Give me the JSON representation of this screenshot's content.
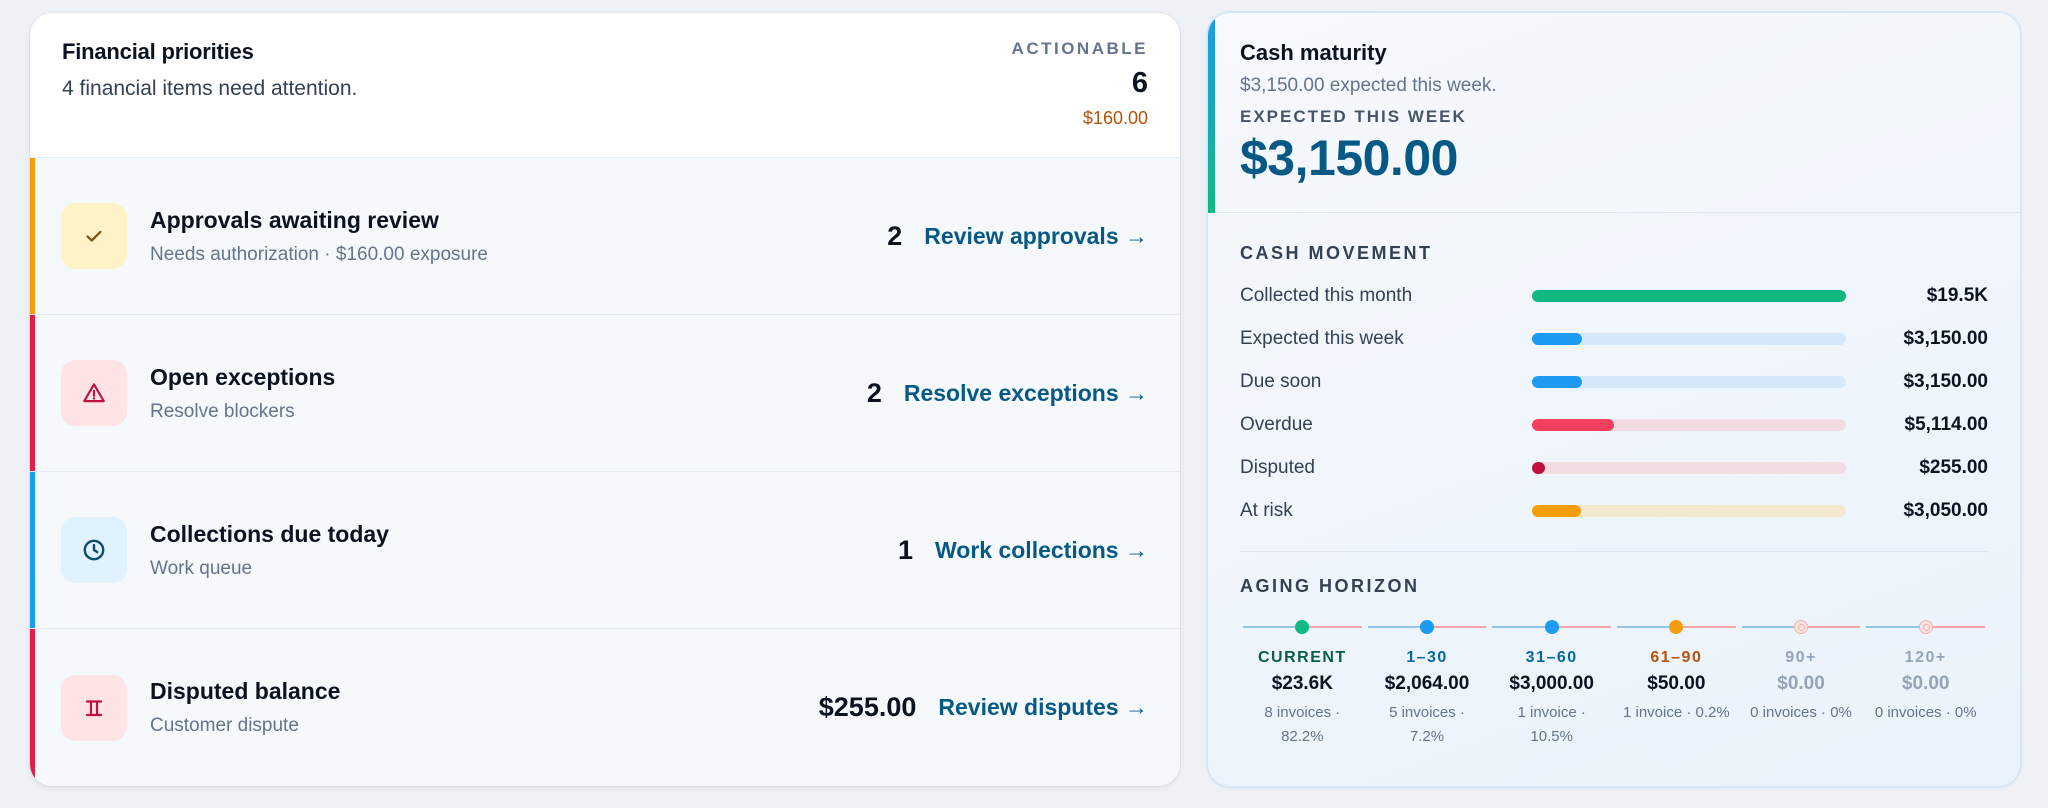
{
  "priorities": {
    "title": "Financial priorities",
    "subtitle": "4 financial items need attention.",
    "actionable_label": "ACTIONABLE",
    "actionable_count": "6",
    "actionable_amount": "$160.00",
    "items": [
      {
        "title": "Approvals awaiting review",
        "subtitle": "Needs authorization · $160.00 exposure",
        "count": "2",
        "link": "Review approvals →",
        "accent": "#f59e0b",
        "icon": "check-icon",
        "icon_color": "#854d0e",
        "icon_bg": "#fef3c7"
      },
      {
        "title": "Open exceptions",
        "subtitle": "Resolve blockers",
        "count": "2",
        "link": "Resolve exceptions →",
        "accent": "#e11d48",
        "icon": "warning-triangle-icon",
        "icon_color": "#be123c",
        "icon_bg": "#ffe4e6"
      },
      {
        "title": "Collections due today",
        "subtitle": "Work queue",
        "count": "1",
        "link": "Work collections →",
        "accent": "#1d9bf0",
        "icon": "clock-icon",
        "icon_color": "#0c4a6e",
        "icon_bg": "#e0f2fe"
      },
      {
        "title": "Disputed balance",
        "subtitle": "Customer dispute",
        "count": "$255.00",
        "link": "Review disputes →",
        "accent": "#e11d48",
        "icon": "dispute-pillar-icon",
        "icon_color": "#be123c",
        "icon_bg": "#ffe4e6"
      }
    ]
  },
  "cash": {
    "title": "Cash maturity",
    "subtitle": "$3,150.00 expected this week.",
    "label": "EXPECTED THIS WEEK",
    "big_value": "$3,150.00",
    "movement_label": "CASH MOVEMENT",
    "movement": [
      {
        "name": "Collected this month",
        "value": "$19.5K",
        "fill": 1.0,
        "color": "#10b981",
        "track": "#d1fae5"
      },
      {
        "name": "Expected this week",
        "value": "$3,150.00",
        "fill": 0.16,
        "color": "#1d9bf0",
        "track": "#d6e9fa"
      },
      {
        "name": "Due soon",
        "value": "$3,150.00",
        "fill": 0.16,
        "color": "#1d9bf0",
        "track": "#d6e9fa"
      },
      {
        "name": "Overdue",
        "value": "$5,114.00",
        "fill": 0.26,
        "color": "#f43f5e",
        "track": "#f3dbe2"
      },
      {
        "name": "Disputed",
        "value": "$255.00",
        "fill": 0.04,
        "color": "#be123c",
        "track": "#f3dbe2"
      },
      {
        "name": "At risk",
        "value": "$3,050.00",
        "fill": 0.155,
        "color": "#f59e0b",
        "track": "#f5e8d0"
      }
    ],
    "aging_label": "AGING HORIZON",
    "aging": [
      {
        "label": "CURRENT",
        "amount": "$23.6K",
        "meta": "8 invoices · 82.2%",
        "dot": "#10b981",
        "label_color": "#065f46",
        "muted": false
      },
      {
        "label": "1–30",
        "amount": "$2,064.00",
        "meta": "5 invoices · 7.2%",
        "dot": "#1d9bf0",
        "label_color": "#0369a1",
        "muted": false
      },
      {
        "label": "31–60",
        "amount": "$3,000.00",
        "meta": "1 invoice · 10.5%",
        "dot": "#1d9bf0",
        "label_color": "#0369a1",
        "muted": false
      },
      {
        "label": "61–90",
        "amount": "$50.00",
        "meta": "1 invoice · 0.2%",
        "dot": "#f59e0b",
        "label_color": "#b45309",
        "muted": false
      },
      {
        "label": "90+",
        "amount": "$0.00",
        "meta": "0 invoices · 0%",
        "dot": "ring",
        "label_color": "#94a3b8",
        "muted": true
      },
      {
        "label": "120+",
        "amount": "$0.00",
        "meta": "0 invoices · 0%",
        "dot": "ring",
        "label_color": "#94a3b8",
        "muted": true
      }
    ]
  }
}
